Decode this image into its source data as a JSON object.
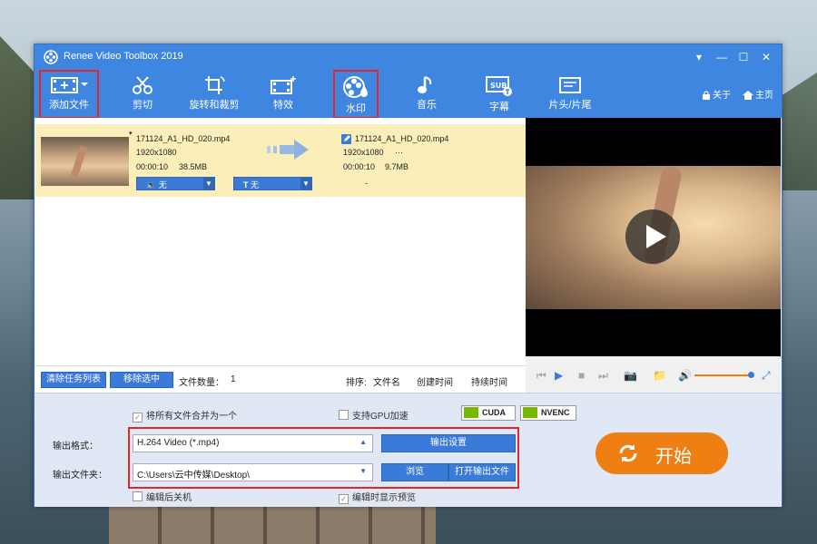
{
  "window": {
    "title": "Renee Video Toolbox 2019",
    "controls": [
      "▾",
      "—",
      "☐",
      "✕"
    ]
  },
  "toolbar": {
    "items": [
      {
        "id": "add",
        "label": "添加文件",
        "icon": "add-file-icon"
      },
      {
        "id": "cut",
        "label": "剪切",
        "icon": "scissors-icon"
      },
      {
        "id": "rotate",
        "label": "旋转和裁剪",
        "icon": "crop-rotate-icon"
      },
      {
        "id": "effects",
        "label": "特效",
        "icon": "effects-icon"
      },
      {
        "id": "watermark",
        "label": "水印",
        "icon": "watermark-icon"
      },
      {
        "id": "music",
        "label": "音乐",
        "icon": "music-note-icon"
      },
      {
        "id": "subtitle",
        "label": "字幕",
        "icon": "subtitle-icon"
      },
      {
        "id": "intro",
        "label": "片头/片尾",
        "icon": "intro-outro-icon"
      }
    ],
    "about": "关于",
    "home": "主页"
  },
  "file": {
    "source": {
      "name": "171124_A1_HD_020.mp4",
      "resolution": "1920x1080",
      "duration": "00:00:10",
      "size": "38.5MB"
    },
    "output": {
      "name": "171124_A1_HD_020.mp4",
      "resolution": "1920x1080",
      "extra": "···",
      "duration": "00:00:10",
      "size": "9.7MB",
      "dash": "-"
    },
    "audio_label": "无",
    "subtitle_label": "无"
  },
  "list_footer": {
    "clear": "清除任务列表",
    "remove": "移除选中",
    "count_label": "文件数量：",
    "count": "1",
    "sort_label": "排序:",
    "sort_name": "文件名",
    "sort_created": "创建时间",
    "sort_duration": "持续时间"
  },
  "options": {
    "merge": "将所有文件合并为一个",
    "gpu": "支持GPU加速",
    "cuda": "CUDA",
    "nvenc": "NVENC",
    "shutdown": "编辑后关机",
    "preview": "编辑时显示预览"
  },
  "output": {
    "format_label": "输出格式：",
    "format_value": "H.264 Video (*.mp4)",
    "settings": "输出设置",
    "folder_label": "输出文件夹：",
    "folder_value": "C:\\Users\\云中传媒\\Desktop\\",
    "browse": "浏览",
    "open": "打开输出文件"
  },
  "start": {
    "label": "开始"
  },
  "colors": {
    "accent": "#3f86e0",
    "start": "#f07f13",
    "highlight": "#e2262a",
    "row": "#fbeeb9"
  }
}
